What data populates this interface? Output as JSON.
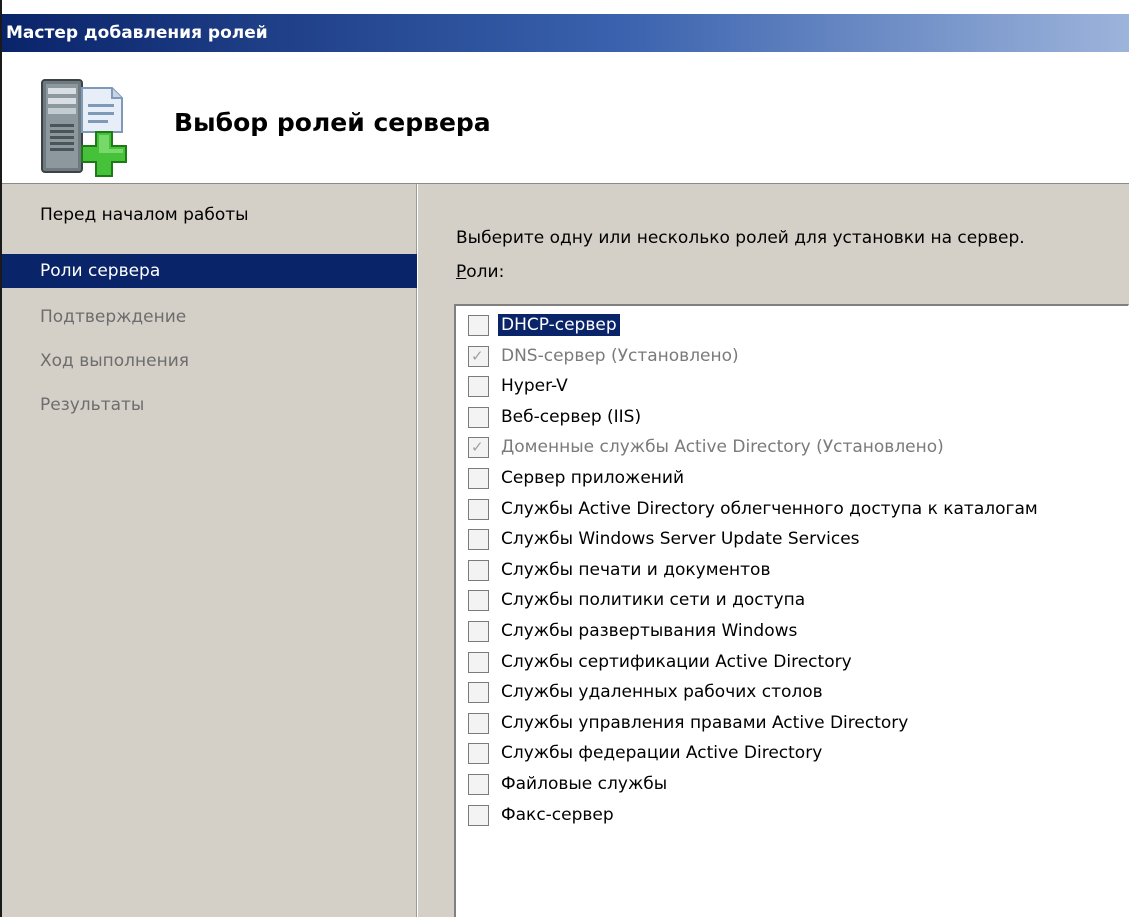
{
  "window": {
    "title": "Мастер добавления ролей"
  },
  "header": {
    "title": "Выбор ролей сервера",
    "icon": "server-add-icon"
  },
  "nav": {
    "items": [
      {
        "label": "Перед началом работы",
        "state": "normal"
      },
      {
        "label": "Роли сервера",
        "state": "active"
      },
      {
        "label": "Подтверждение",
        "state": "disabled"
      },
      {
        "label": "Ход выполнения",
        "state": "disabled"
      },
      {
        "label": "Результаты",
        "state": "disabled"
      }
    ]
  },
  "content": {
    "instruction": "Выберите одну или несколько ролей для установки на сервер.",
    "roles_label_accel": "Р",
    "roles_label_rest": "оли:",
    "roles": [
      {
        "label": "DHCP-сервер",
        "checked": false,
        "disabled": false,
        "selected": true
      },
      {
        "label": "DNS-сервер (Установлено)",
        "checked": true,
        "disabled": true,
        "selected": false
      },
      {
        "label": "Hyper-V",
        "checked": false,
        "disabled": false,
        "selected": false
      },
      {
        "label": "Веб-сервер (IIS)",
        "checked": false,
        "disabled": false,
        "selected": false
      },
      {
        "label": "Доменные службы Active Directory (Установлено)",
        "checked": true,
        "disabled": true,
        "selected": false
      },
      {
        "label": "Сервер приложений",
        "checked": false,
        "disabled": false,
        "selected": false
      },
      {
        "label": "Службы Active Directory облегченного доступа к каталогам",
        "checked": false,
        "disabled": false,
        "selected": false
      },
      {
        "label": "Службы Windows Server Update Services",
        "checked": false,
        "disabled": false,
        "selected": false
      },
      {
        "label": "Службы печати и документов",
        "checked": false,
        "disabled": false,
        "selected": false
      },
      {
        "label": "Службы политики сети и доступа",
        "checked": false,
        "disabled": false,
        "selected": false
      },
      {
        "label": "Службы развертывания Windows",
        "checked": false,
        "disabled": false,
        "selected": false
      },
      {
        "label": "Службы сертификации Active Directory",
        "checked": false,
        "disabled": false,
        "selected": false
      },
      {
        "label": "Службы удаленных рабочих столов",
        "checked": false,
        "disabled": false,
        "selected": false
      },
      {
        "label": "Службы управления правами Active Directory",
        "checked": false,
        "disabled": false,
        "selected": false
      },
      {
        "label": "Службы федерации Active Directory",
        "checked": false,
        "disabled": false,
        "selected": false
      },
      {
        "label": "Файловые службы",
        "checked": false,
        "disabled": false,
        "selected": false
      },
      {
        "label": "Факс-сервер",
        "checked": false,
        "disabled": false,
        "selected": false
      }
    ]
  },
  "colors": {
    "titlebar": "#0a246a",
    "selection": "#0a246a",
    "panel": "#d4d0c8",
    "disabled_text": "#7a7a7a"
  }
}
